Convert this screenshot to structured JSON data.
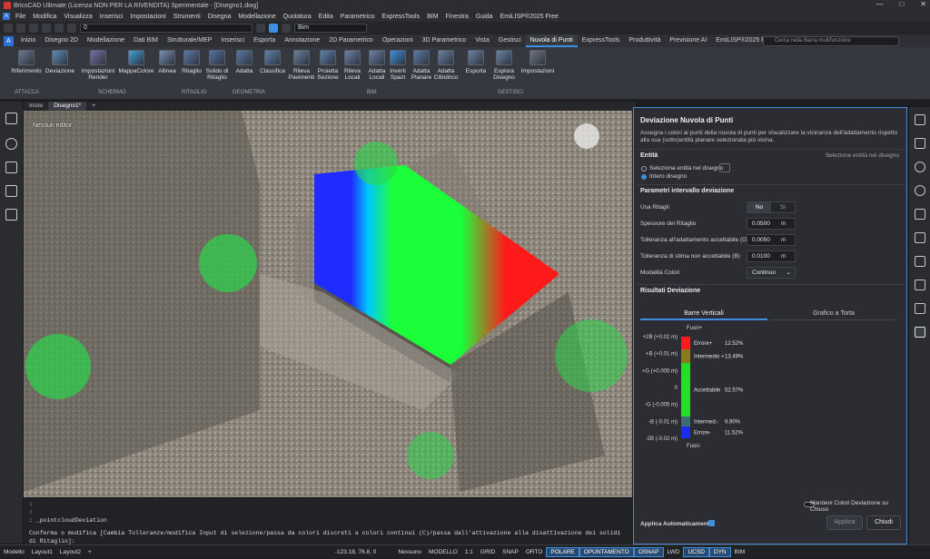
{
  "titlebar": {
    "title": "BricsCAD Ultimate (Licenza NON PER LA RIVENDITA) Sperimentale - [Disegno1.dwg]"
  },
  "menu": [
    "File",
    "Modifica",
    "Visualizza",
    "Inserisci",
    "Impostazioni",
    "Strumenti",
    "Disegna",
    "Modellazione",
    "Quotatura",
    "Edita",
    "Parametrico",
    "ExpressTools",
    "BIM",
    "Finestra",
    "Guida",
    "EmiLISP®2025 Free"
  ],
  "qat": {
    "layer_value": "0",
    "workspace_value": "Bim"
  },
  "ribbon_tabs": [
    "Inizio",
    "Disegno 2D",
    "Modellazione",
    "Dati BIM",
    "Strutturale/MEP",
    "Inserisci",
    "Esporta",
    "Annotazione",
    "2D Parametrico",
    "Operazioni",
    "3D Parametrico",
    "Vista",
    "Gestisci",
    "Nuvola di Punti",
    "ExpressTools",
    "Produttività",
    "Previsione AI",
    "EmiLISP®2025 Free"
  ],
  "ribbon_active": "Nuvola di Punti",
  "search": {
    "placeholder": "Cerca nella Barra multifunzione"
  },
  "ribbon_tools": [
    {
      "label": "Riferimento"
    },
    {
      "label": "Deviazione"
    },
    {
      "label": "Impostazioni Render"
    },
    {
      "label": "MappaColore"
    },
    {
      "label": "Allinea"
    },
    {
      "label": "Ritaglio"
    },
    {
      "label": "Solido di Ritaglio"
    },
    {
      "label": "Adatta"
    },
    {
      "label": "Classifica"
    },
    {
      "label": "Rileva Pavimenti"
    },
    {
      "label": "Proietta Sezione"
    },
    {
      "label": "Rileva Locali"
    },
    {
      "label": "Adatta Locali"
    },
    {
      "label": "Inverti Spazi"
    },
    {
      "label": "Adatta Planare"
    },
    {
      "label": "Adatta Cilindrico"
    },
    {
      "label": "Esporta"
    },
    {
      "label": "Esplora Disegno"
    },
    {
      "label": "Impostazioni"
    }
  ],
  "ribbon_groups": [
    "ATTACCA",
    "SCHERMO",
    "RITAGLIO",
    "GEOMETRIA",
    "BIM",
    "GESTISCI"
  ],
  "doc_tabs": [
    "Inizio",
    "Disegno1*"
  ],
  "viewport": {
    "label": "Nessun editor"
  },
  "command": {
    "lines": [
      ":",
      ":",
      ": _pointcloudDeviation"
    ],
    "prompt_line": "Conferma o modifica [Cambia Tolleranze/modifica Input di selezione/passa da colori discreti a colori continui (C)/passa dall'attivazione alla disattivazione dei solidi di Ritaglio]:"
  },
  "panel": {
    "title": "Deviazione Nuvola di Punti",
    "description": "Assegna i colori ai punti della nuvola di punti per visualizzare la vicinanza dell'adattamento rispetto alla sua (sotto)entità planare selezionata più vicina.",
    "entity_section": "Entità",
    "entity_hint": "Selezione entità nel disegno",
    "radio_select": "Seleziona entità nel disegno",
    "radio_all": "Intero disegno",
    "params_section": "Parametri intervallo deviazione",
    "use_clip_label": "Usa Ritagli:",
    "no_label": "No",
    "yes_label": "Sì",
    "thickness_label": "Spessore del Ritaglio",
    "thickness_value": "0.0500",
    "tol_g_label": "Tolleranza all'adattamento accettabile (G)",
    "tol_g_value": "0.0050",
    "tol_b_label": "Tolleranza di stima non accettabile (B)",
    "tol_b_value": "0.0100",
    "unit": "m",
    "color_mode_label": "Modalità Colori",
    "color_mode_value": "Continuo",
    "results_section": "Risultati Deviazione",
    "tab_bars": "Barre Verticali",
    "tab_pie": "Grafico a Torta",
    "out_top": "Fuori+",
    "out_bottom": "Fuori-",
    "keep_colors_label": "Mantieni Colori Deviazione su Chiuso",
    "auto_apply_label": "Applica Automaticamente",
    "apply_btn": "Applica",
    "close_btn": "Chiudi"
  },
  "chart_data": {
    "type": "bar",
    "categories": [
      "Errore+",
      "Intermedio +",
      "Accettabile",
      "Intermed.-",
      "Errore-"
    ],
    "values": [
      12.52,
      13.49,
      52.57,
      9.9,
      11.52
    ],
    "labels_pct": [
      "12.52%",
      "13.49%",
      "52.57%",
      "9.90%",
      "11.52%"
    ],
    "colors": [
      "#ff1a1a",
      "#8a7a1a",
      "#22e022",
      "#3b6f73",
      "#1a2cf0"
    ],
    "axis_labels": [
      "+2B (+0.02 m)",
      "+B (+0.01 m)",
      "+G (+0.005 m)",
      "0",
      "-G (-0.005 m)",
      "-B (-0.01 m)",
      "-2B (-0.02 m)"
    ]
  },
  "statusbar": {
    "tabs": [
      "Modello",
      "Layout1",
      "Layout2"
    ],
    "coords": "-123.18, 76.8, 0",
    "items": [
      "Nessuno",
      "MODELLO",
      "1:1",
      "GRID",
      "SNAP",
      "ORTO",
      "POLARE",
      "OPUNTAMENTO",
      "OSNAP",
      "LWD",
      "UCSD",
      "DYN",
      "BIM"
    ]
  },
  "colors": {
    "accent": "#3d8fe0",
    "panel_bg": "#2b2d32"
  }
}
